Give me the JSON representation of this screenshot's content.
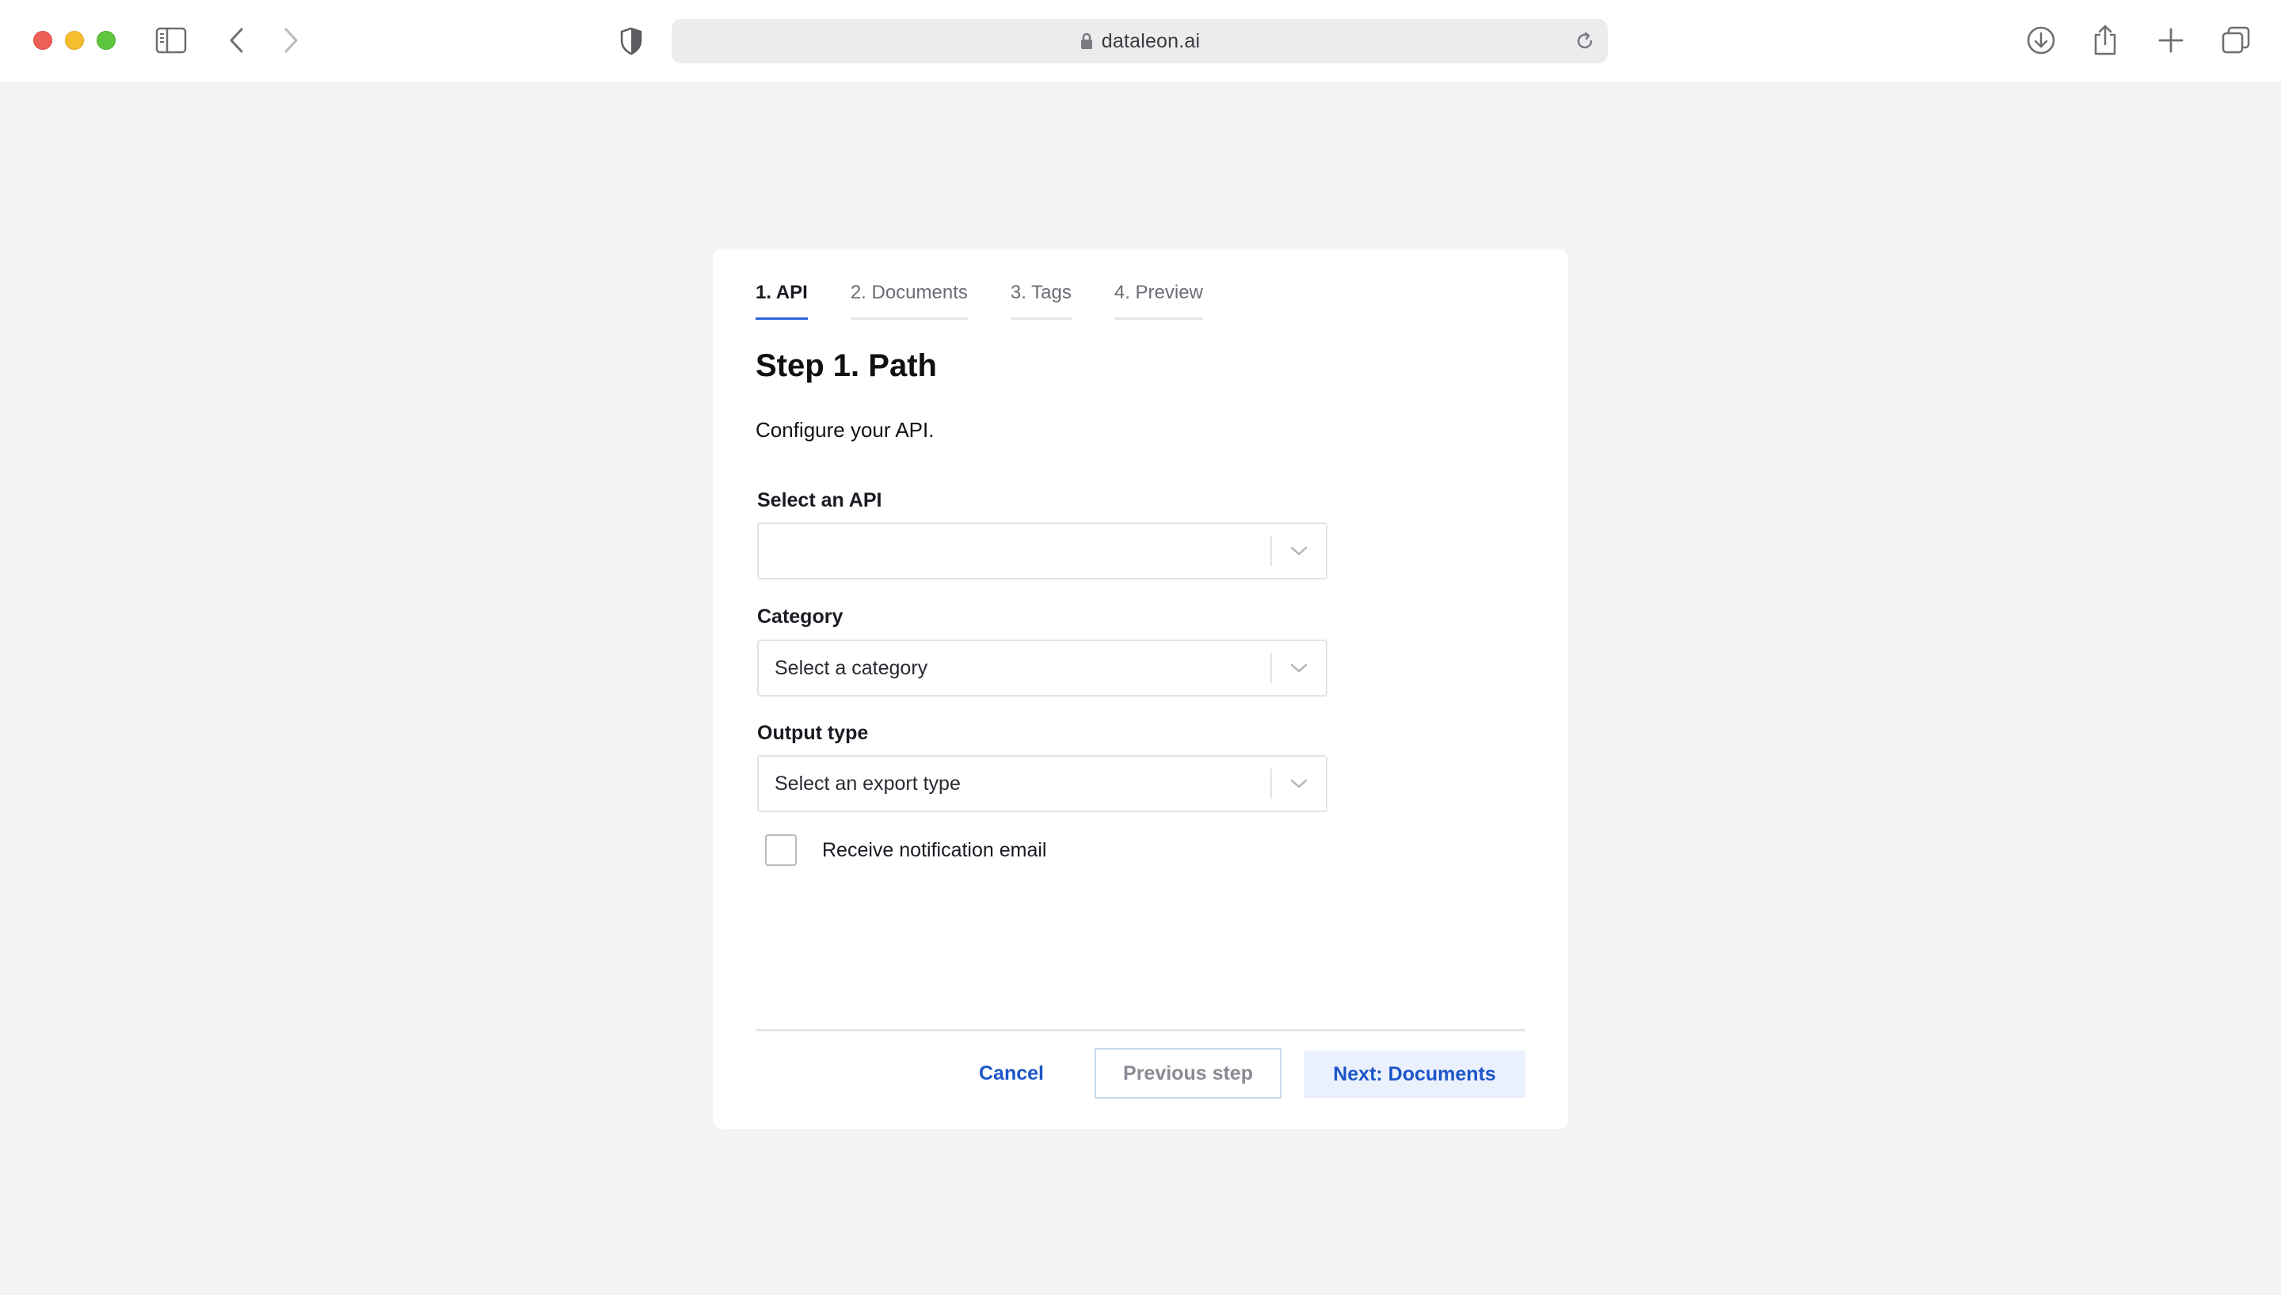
{
  "browser": {
    "url": "dataleon.ai",
    "icons": [
      "sidebar-icon",
      "back-icon",
      "forward-icon",
      "shield-icon",
      "lock-icon",
      "reload-icon",
      "download-icon",
      "share-icon",
      "new-tab-icon",
      "tabs-overview-icon"
    ]
  },
  "wizard": {
    "tabs": [
      {
        "label": "1. API",
        "active": true
      },
      {
        "label": "2. Documents",
        "active": false
      },
      {
        "label": "3. Tags",
        "active": false
      },
      {
        "label": "4. Preview",
        "active": false
      }
    ],
    "heading": "Step 1. Path",
    "subtitle": "Configure your API.",
    "fields": {
      "api": {
        "label": "Select an API",
        "value": ""
      },
      "category": {
        "label": "Category",
        "placeholder": "Select a category"
      },
      "output": {
        "label": "Output type",
        "placeholder": "Select an export type"
      }
    },
    "notification": {
      "label": "Receive notification email",
      "checked": false
    },
    "buttons": {
      "cancel": "Cancel",
      "previous": "Previous step",
      "next": "Next: Documents"
    }
  },
  "colors": {
    "accent": "#2d63d9",
    "button_text": "#1c56c8",
    "next_bg": "#eaf1fd",
    "page_bg": "#f3f2f5"
  }
}
